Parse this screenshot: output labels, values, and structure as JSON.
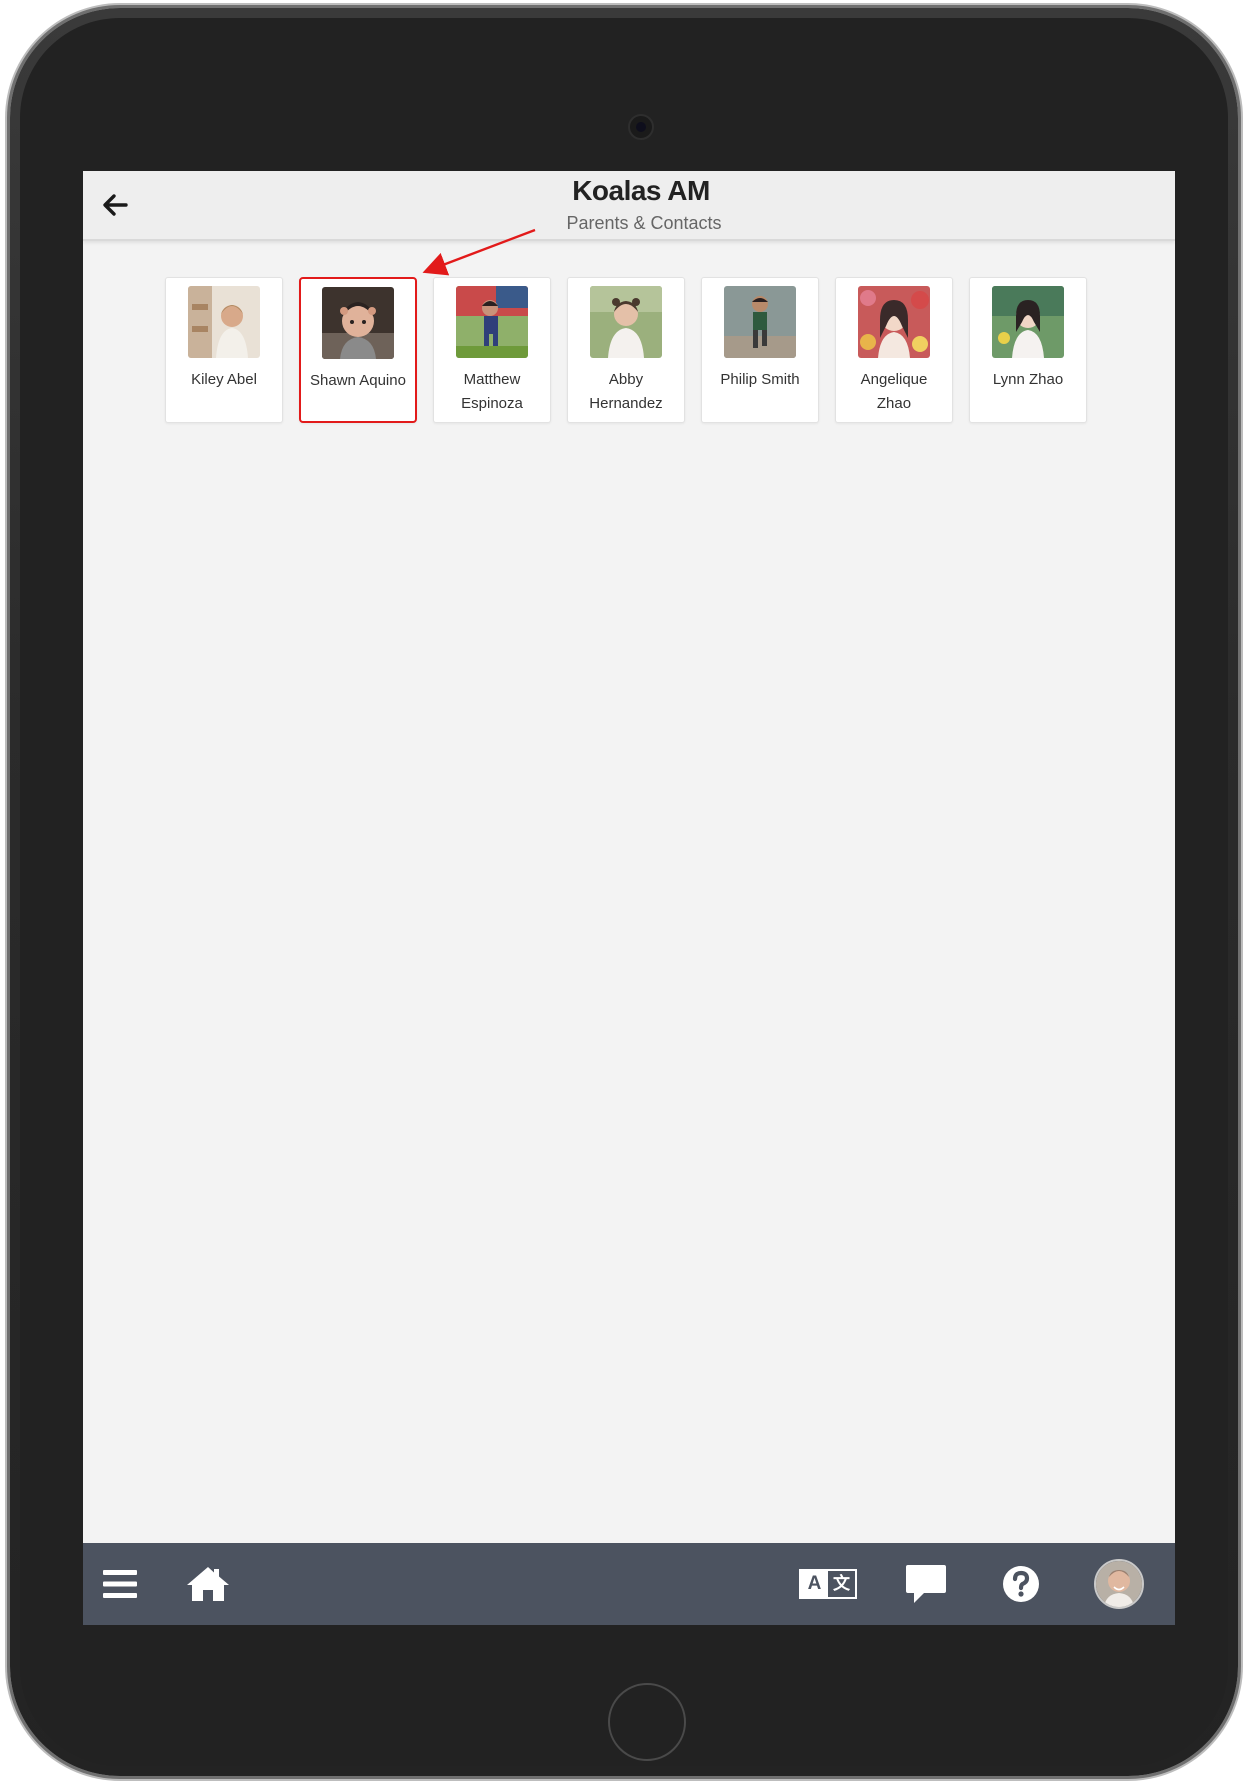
{
  "header": {
    "title": "Koalas AM",
    "subtitle": "Parents & Contacts"
  },
  "students": [
    {
      "name": "Kiley Abel",
      "selected": false,
      "photo_colors": [
        "#d8cbbf",
        "#b98f6b",
        "#f1ede6"
      ]
    },
    {
      "name": "Shawn Aquino",
      "selected": true,
      "photo_colors": [
        "#3a2f2a",
        "#c89a83",
        "#8a8a8a"
      ]
    },
    {
      "name": "Matthew Espinoza",
      "selected": false,
      "photo_colors": [
        "#cf2f2f",
        "#2f3b6e",
        "#6a9a3a"
      ]
    },
    {
      "name": "Abby Hernandez",
      "selected": false,
      "photo_colors": [
        "#8aa06a",
        "#f2ede8",
        "#5b4a3b"
      ]
    },
    {
      "name": "Philip Smith",
      "selected": false,
      "photo_colors": [
        "#7b8a88",
        "#2e4a3a",
        "#b98a6a"
      ]
    },
    {
      "name": "Angelique Zhao",
      "selected": false,
      "photo_colors": [
        "#d44a5a",
        "#f2e2d6",
        "#3a2a2a"
      ]
    },
    {
      "name": "Lynn Zhao",
      "selected": false,
      "photo_colors": [
        "#6a8a5a",
        "#f3f0ee",
        "#2a2a2a"
      ]
    }
  ],
  "annotation": {
    "color": "#e21a1a"
  },
  "bottom_bar": {
    "icons": [
      "menu-icon",
      "home-icon",
      "translate-icon",
      "chat-icon",
      "help-icon",
      "user-avatar"
    ],
    "translate_glyph_left": "A",
    "translate_glyph_right": "文"
  },
  "colors": {
    "bottom_bar": "#4c5360",
    "header_bg": "#eeeeee",
    "screen_bg": "#f3f3f3",
    "selected_border": "#e21a1a"
  }
}
